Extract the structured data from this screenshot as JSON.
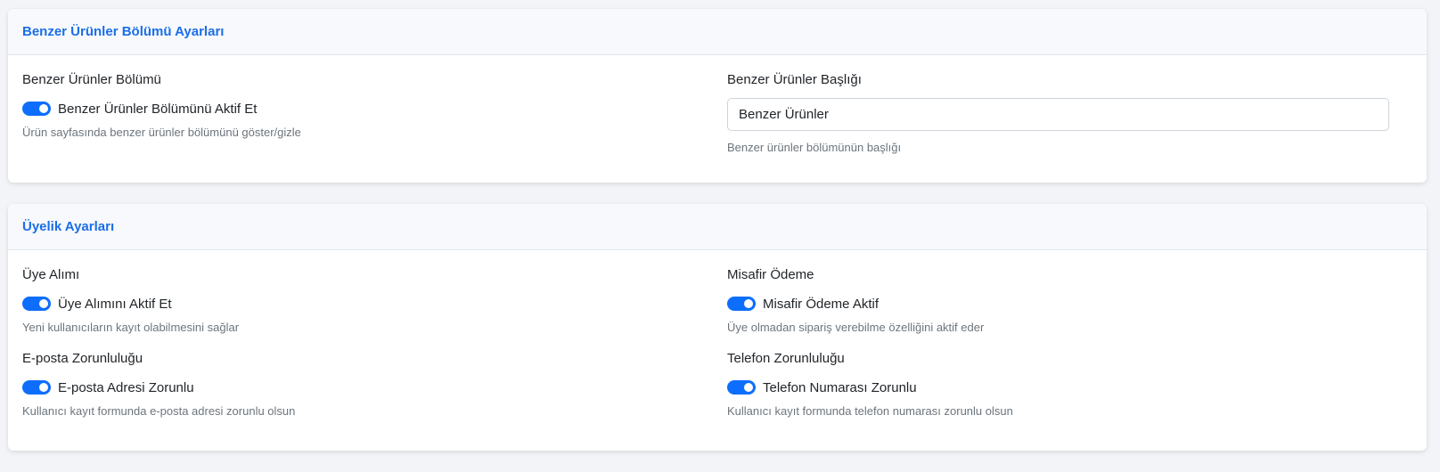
{
  "similar_products": {
    "title": "Benzer Ürünler Bölümü Ayarları",
    "section_label": "Benzer Ürünler Bölümü",
    "toggle_label": "Benzer Ürünler Bölümünü Aktif Et",
    "toggle_on": true,
    "toggle_help": "Ürün sayfasında benzer ürünler bölümünü göster/gizle",
    "heading_label": "Benzer Ürünler Başlığı",
    "heading_value": "Benzer Ürünler",
    "heading_help": "Benzer ürünler bölümünün başlığı"
  },
  "membership": {
    "title": "Üyelik Ayarları",
    "registration": {
      "label": "Üye Alımı",
      "toggle_label": "Üye Alımını Aktif Et",
      "toggle_on": true,
      "help": "Yeni kullanıcıların kayıt olabilmesini sağlar"
    },
    "guest_checkout": {
      "label": "Misafir Ödeme",
      "toggle_label": "Misafir Ödeme Aktif",
      "toggle_on": true,
      "help": "Üye olmadan sipariş verebilme özelliğini aktif eder"
    },
    "email_required": {
      "label": "E-posta Zorunluluğu",
      "toggle_label": "E-posta Adresi Zorunlu",
      "toggle_on": true,
      "help": "Kullanıcı kayıt formunda e-posta adresi zorunlu olsun"
    },
    "phone_required": {
      "label": "Telefon Zorunluluğu",
      "toggle_label": "Telefon Numarası Zorunlu",
      "toggle_on": true,
      "help": "Kullanıcı kayıt formunda telefon numarası zorunlu olsun"
    }
  },
  "colors": {
    "accent": "#0d6efd",
    "title": "#1a6ee8",
    "help_text": "#6c757d",
    "page_bg": "#f3f4f8"
  }
}
